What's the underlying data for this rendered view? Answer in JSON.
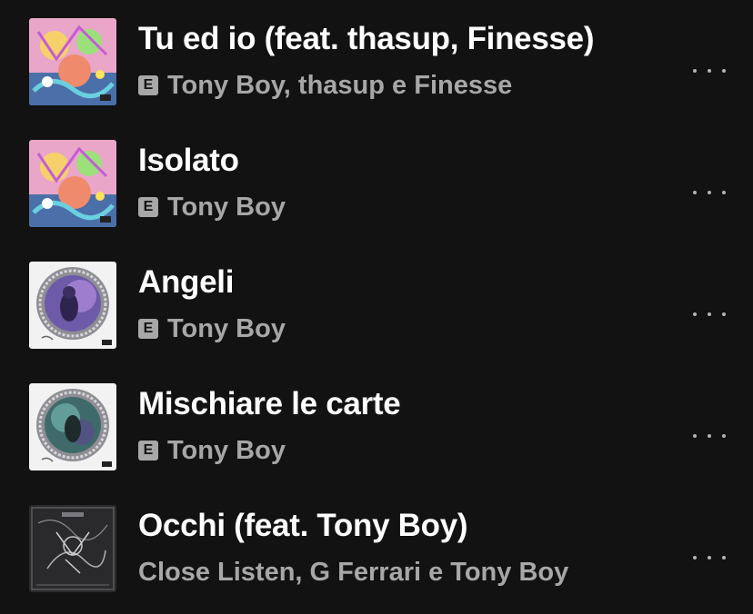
{
  "tracks": [
    {
      "title": "Tu ed io (feat. thasup, Finesse)",
      "artists": "Tony Boy, thasup e Finesse",
      "explicit": true,
      "explicit_label": "E",
      "cover": "colorful-illustrated-album-art-icon"
    },
    {
      "title": "Isolato",
      "artists": "Tony Boy",
      "explicit": true,
      "explicit_label": "E",
      "cover": "colorful-illustrated-album-art-icon"
    },
    {
      "title": "Angeli",
      "artists": "Tony Boy",
      "explicit": true,
      "explicit_label": "E",
      "cover": "silver-framed-portrait-album-art-icon"
    },
    {
      "title": "Mischiare le carte",
      "artists": "Tony Boy",
      "explicit": true,
      "explicit_label": "E",
      "cover": "silver-framed-portrait-album-art-icon"
    },
    {
      "title": "Occhi (feat. Tony Boy)",
      "artists": "Close Listen, G Ferrari e Tony Boy",
      "explicit": false,
      "explicit_label": "",
      "cover": "dark-sketch-album-art-icon"
    }
  ]
}
